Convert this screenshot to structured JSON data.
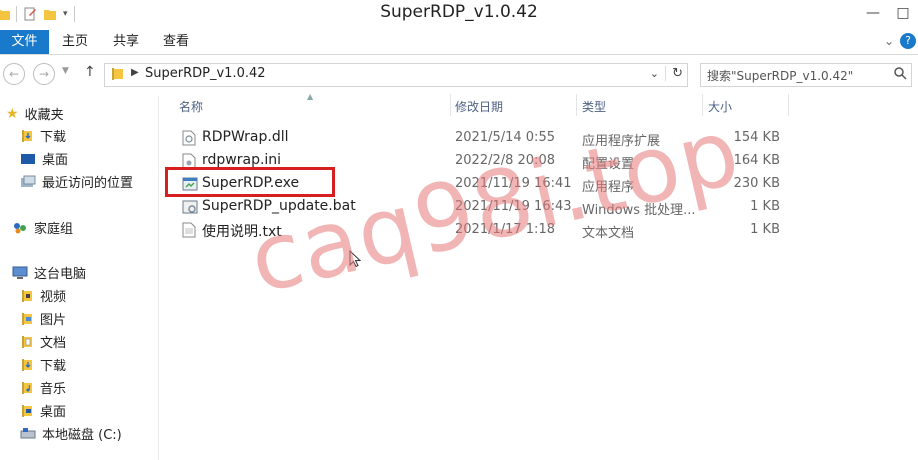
{
  "window": {
    "title": "SuperRDP_v1.0.42"
  },
  "ribbon": {
    "tabs": [
      "文件",
      "主页",
      "共享",
      "查看"
    ]
  },
  "address": {
    "path": "SuperRDP_v1.0.42",
    "search_placeholder": "搜索\"SuperRDP_v1.0.42\""
  },
  "sidebar": {
    "items": [
      {
        "label": "收藏夹",
        "icon": "star-icon"
      },
      {
        "label": "下载",
        "icon": "download-folder-icon"
      },
      {
        "label": "桌面",
        "icon": "desktop-icon"
      },
      {
        "label": "最近访问的位置",
        "icon": "recent-places-icon"
      },
      {
        "label": "家庭组",
        "icon": "homegroup-icon"
      },
      {
        "label": "这台电脑",
        "icon": "computer-icon"
      },
      {
        "label": "视频",
        "icon": "video-folder-icon"
      },
      {
        "label": "图片",
        "icon": "pictures-folder-icon"
      },
      {
        "label": "文档",
        "icon": "documents-folder-icon"
      },
      {
        "label": "下载",
        "icon": "download-folder-icon"
      },
      {
        "label": "音乐",
        "icon": "music-folder-icon"
      },
      {
        "label": "桌面",
        "icon": "desktop-folder-icon"
      },
      {
        "label": "本地磁盘 (C:)",
        "icon": "disk-icon"
      }
    ]
  },
  "columns": {
    "name": "名称",
    "date": "修改日期",
    "type": "类型",
    "size": "大小"
  },
  "files": [
    {
      "name": "RDPWrap.dll",
      "date": "2021/5/14 0:55",
      "type": "应用程序扩展",
      "size": "154 KB",
      "icon": "dll-file-icon"
    },
    {
      "name": "rdpwrap.ini",
      "date": "2022/2/8 20:08",
      "type": "配置设置",
      "size": "164 KB",
      "icon": "ini-file-icon"
    },
    {
      "name": "SuperRDP.exe",
      "date": "2021/11/19 16:41",
      "type": "应用程序",
      "size": "230 KB",
      "icon": "exe-file-icon"
    },
    {
      "name": "SuperRDP_update.bat",
      "date": "2021/11/19 16:43",
      "type": "Windows 批处理...",
      "size": "1 KB",
      "icon": "bat-file-icon"
    },
    {
      "name": "使用说明.txt",
      "date": "2021/1/17 1:18",
      "type": "文本文档",
      "size": "1 KB",
      "icon": "txt-file-icon"
    }
  ],
  "watermark": "caq98i.top",
  "colors": {
    "file_tab": "#1979ca",
    "highlight_box": "#d81f1f",
    "watermark": "#e87878"
  }
}
